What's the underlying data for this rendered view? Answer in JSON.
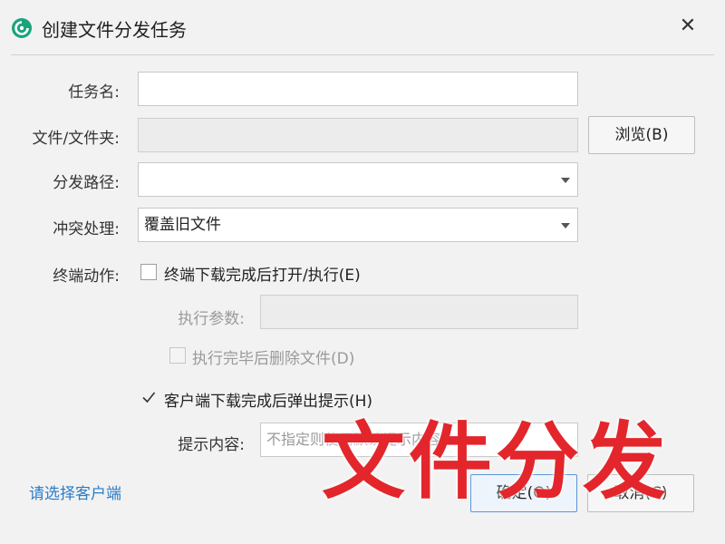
{
  "window": {
    "title": "创建文件分发任务",
    "close_glyph": "✕"
  },
  "form": {
    "task_name": {
      "label": "任务名:",
      "value": ""
    },
    "file": {
      "label": "文件/文件夹:",
      "value": "",
      "browse_label": "浏览(B)"
    },
    "path": {
      "label": "分发路径:",
      "value": ""
    },
    "conflict": {
      "label": "冲突处理:",
      "value": "覆盖旧文件"
    },
    "terminal_action": {
      "label": "终端动作:",
      "open_exec": {
        "label": "终端下载完成后打开/执行(E)",
        "checked": false
      },
      "exec_params": {
        "label": "执行参数:",
        "value": ""
      },
      "delete_after": {
        "label": "执行完毕后删除文件(D)",
        "checked": false
      }
    },
    "popup_hint": {
      "label": "客户端下载完成后弹出提示(H)",
      "checked": true
    },
    "hint_content": {
      "label": "提示内容:",
      "placeholder": "不指定则使用默认提示内容"
    }
  },
  "footer": {
    "select_clients_link": "请选择客户端",
    "ok_label": "确定(O)",
    "cancel_label": "取消(C)"
  },
  "watermark": "文件分发",
  "colors": {
    "accent": "#2a7cc7",
    "watermark": "#e3262c",
    "icon": "#1aa37a"
  },
  "icons": {
    "app": "app-logo-icon",
    "close": "close-icon",
    "dropdown": "chevron-down-icon",
    "check": "checkmark-icon"
  }
}
